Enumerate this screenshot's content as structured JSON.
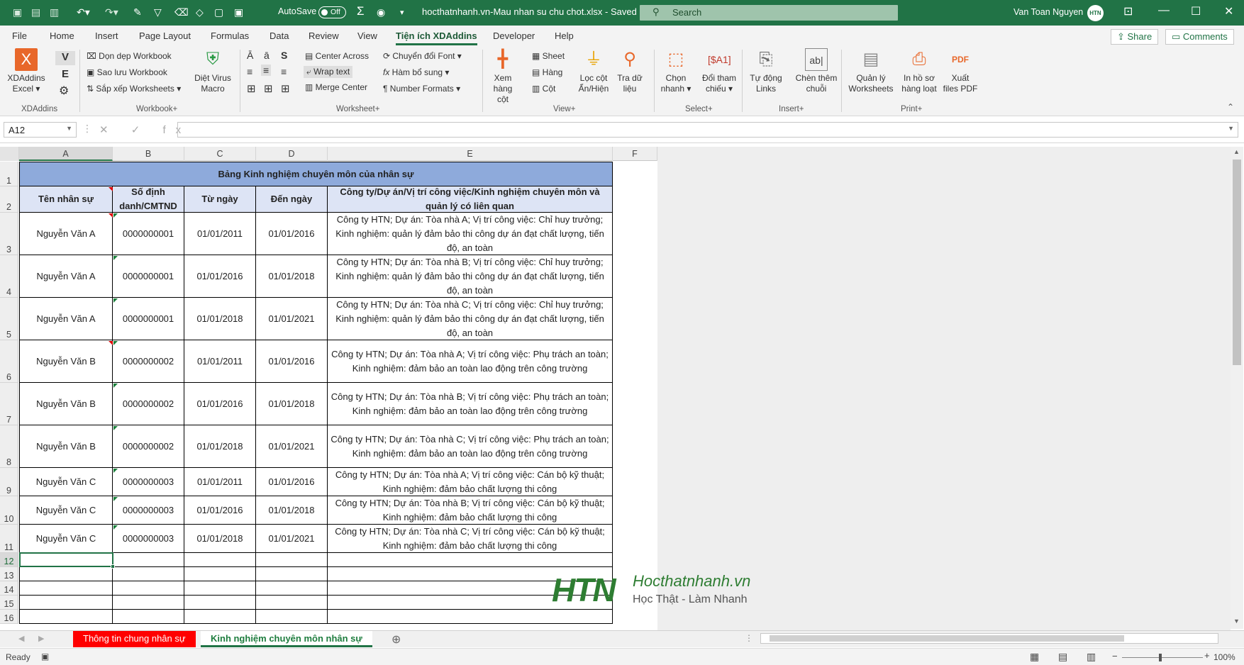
{
  "titlebar": {
    "autosave_label": "AutoSave",
    "autosave_state": "Off",
    "filename": "hocthatnhanh.vn-Mau nhan su chu chot.xlsx",
    "sep": "-",
    "saved": "Saved",
    "search_placeholder": "Search",
    "user_name": "Van Toan Nguyen",
    "avatar": "HTN"
  },
  "tabs": [
    "File",
    "Home",
    "Insert",
    "Page Layout",
    "Formulas",
    "Data",
    "Review",
    "View",
    "Tiện ích XDAddins",
    "Developer",
    "Help"
  ],
  "share_label": "Share",
  "comments_label": "Comments",
  "ribbon": {
    "xdaddins": {
      "line1": "XDAddins",
      "line2": "Excel",
      "v": "V",
      "e": "E",
      "group": "XDAddins"
    },
    "workbook": {
      "cleanup": "Dọn dẹp Workbook",
      "backup": "Sao lưu Workbook",
      "sort": "Sắp xếp Worksheets",
      "virus1": "Diệt Virus",
      "virus2": "Macro",
      "group": "Workbook+"
    },
    "worksheet": {
      "center_across": "Center Across",
      "wrap_text": "Wrap text",
      "merge_center": "Merge Center",
      "convert_font": "Chuyển đổi Font",
      "functions": "Hàm bổ sung",
      "number_formats": "Number Formats",
      "s_label": "S",
      "group": "Worksheet+"
    },
    "view": {
      "xem1": "Xem",
      "xem2": "hàng cột",
      "sheet": "Sheet",
      "hang": "Hàng",
      "cot": "Cột",
      "loc1": "Lọc cột",
      "loc2": "Ẩn/Hiện",
      "tra1": "Tra dữ",
      "tra2": "liệu",
      "group": "View+"
    },
    "select": {
      "chon1": "Chọn",
      "chon2": "nhanh",
      "doi1": "Đổi tham",
      "doi2": "chiếu",
      "a1": "[$A1]",
      "group": "Select+"
    },
    "insert": {
      "tudong1": "Tự động",
      "tudong2": "Links",
      "chen1": "Chèn thêm",
      "chen2": "chuỗi",
      "abl": "ab|",
      "group": "Insert+"
    },
    "print": {
      "ql1": "Quản lý",
      "ql2": "Worksheets",
      "in1": "In hồ sơ",
      "in2": "hàng loạt",
      "xuat1": "Xuất",
      "xuat2": "files PDF",
      "pdf": "PDF",
      "group": "Print+"
    }
  },
  "namebox": "A12",
  "fx_symbols": "✕ ✓ fx",
  "columns": [
    "A",
    "B",
    "C",
    "D",
    "E",
    "F"
  ],
  "rows_extra": [
    "12",
    "13",
    "14",
    "15",
    "16"
  ],
  "table": {
    "title": "Bảng Kinh nghiệm chuyên môn của nhân sự",
    "headers": [
      "Tên nhân sự",
      "Số định danh/CMTND",
      "Từ ngày",
      "Đến ngày",
      "Công ty/Dự án/Vị trí công việc/Kinh nghiệm chuyên môn và quản lý có liên quan"
    ],
    "rows": [
      [
        "Nguyễn Văn A",
        "0000000001",
        "01/01/2011",
        "01/01/2016",
        "Công ty HTN; Dự án: Tòa nhà A; Vị trí công việc: Chỉ huy trưởng; Kinh nghiệm: quản lý đảm bảo thi công dự án đạt chất lượng, tiến độ, an toàn"
      ],
      [
        "Nguyễn Văn A",
        "0000000001",
        "01/01/2016",
        "01/01/2018",
        "Công ty HTN; Dự án: Tòa nhà B; Vị trí công việc: Chỉ huy trưởng; Kinh nghiệm: quản lý đảm bảo thi công dự án đạt chất lượng, tiến độ, an toàn"
      ],
      [
        "Nguyễn Văn A",
        "0000000001",
        "01/01/2018",
        "01/01/2021",
        "Công ty HTN; Dự án: Tòa nhà C; Vị trí công việc: Chỉ huy trưởng; Kinh nghiệm: quản lý đảm bảo thi công dự án đạt chất lượng, tiến độ, an toàn"
      ],
      [
        "Nguyễn Văn B",
        "0000000002",
        "01/01/2011",
        "01/01/2016",
        "Công ty HTN; Dự án: Tòa nhà A; Vị trí công việc: Phụ trách an toàn; Kinh nghiệm: đảm bảo an toàn lao động trên công trường"
      ],
      [
        "Nguyễn Văn B",
        "0000000002",
        "01/01/2016",
        "01/01/2018",
        "Công ty HTN; Dự án: Tòa nhà B; Vị trí công việc: Phụ trách an toàn; Kinh nghiệm: đảm bảo an toàn lao động trên công trường"
      ],
      [
        "Nguyễn Văn B",
        "0000000002",
        "01/01/2018",
        "01/01/2021",
        "Công ty HTN; Dự án: Tòa nhà C; Vị trí công việc: Phụ trách an toàn; Kinh nghiệm: đảm bảo an toàn lao động trên công trường"
      ],
      [
        "Nguyễn Văn C",
        "0000000003",
        "01/01/2011",
        "01/01/2016",
        "Công ty HTN; Dự án: Tòa nhà A; Vị trí công việc: Cán bộ kỹ thuật; Kinh nghiệm: đảm bảo chất lượng thi công"
      ],
      [
        "Nguyễn Văn C",
        "0000000003",
        "01/01/2016",
        "01/01/2018",
        "Công ty HTN; Dự án: Tòa nhà B; Vị trí công việc: Cán bộ kỹ thuật; Kinh nghiệm: đảm bảo chất lượng thi công"
      ],
      [
        "Nguyễn Văn C",
        "0000000003",
        "01/01/2018",
        "01/01/2021",
        "Công ty HTN; Dự án: Tòa nhà C; Vị trí công việc: Cán bộ kỹ thuật; Kinh nghiệm: đảm bảo chất lượng thi công"
      ]
    ]
  },
  "logo": {
    "mark": "HTN",
    "site": "Hocthatnhanh.vn",
    "tagline": "Học Thật - Làm Nhanh"
  },
  "sheets": [
    "Thông tin chung nhân sự",
    "Kinh nghiệm chuyên môn nhân sự"
  ],
  "status": {
    "ready": "Ready",
    "zoom": "100%"
  },
  "colors": {
    "excel_green": "#217346",
    "title_fill": "#8eaadb",
    "header_fill": "#dde4f5",
    "red_tab": "#ff0000"
  }
}
